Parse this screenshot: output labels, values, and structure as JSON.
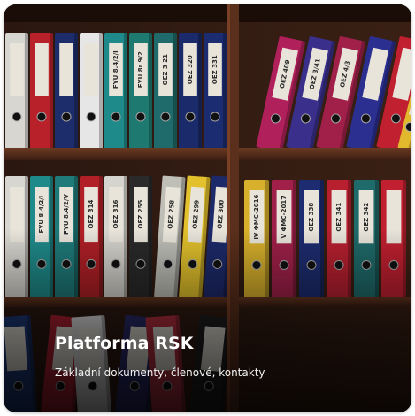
{
  "card": {
    "title": "Platforma RSK",
    "subtitle": "Základní dokumenty, členové, kontakty"
  },
  "binders": {
    "upper_left": [
      "",
      "",
      "",
      "",
      "FYU 8.4/2/I",
      "FYU 8r 9/2",
      "OEZ 3 21",
      "OEZ 320",
      "OEZ 331"
    ],
    "upper_right": [
      "OEZ 409",
      "OEZ 3/41",
      "OEZ 4/3",
      "",
      ""
    ],
    "lower_left": [
      "",
      "FYU 8.4/2/I",
      "FYU 8.4/2/V",
      "OEZ 314",
      "OEZ 316",
      "OEZ 255",
      "OEZ 258",
      "OEZ 299",
      "OEZ 300"
    ],
    "lower_right": [
      "IV ΦMC-2016",
      "V ΦMC-2017",
      "OEZ 338",
      "OEZ 341",
      "OEZ 342",
      ""
    ]
  }
}
